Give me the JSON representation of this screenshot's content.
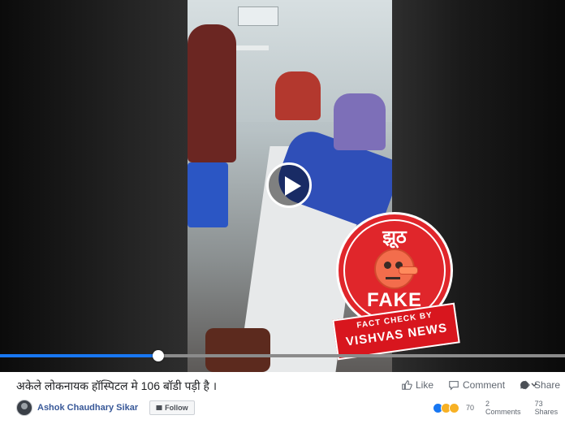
{
  "video": {
    "progress_fraction": 0.28
  },
  "fact_check_badge": {
    "top_word": "झूठ",
    "verdict": "FAKE",
    "banner_small": "FACT CHECK BY",
    "banner_big": "VISHVAS NEWS"
  },
  "post": {
    "caption": "अकेले लोकनायक हॉस्पिटल मे 106 बॉडी पड़ी है ।",
    "author": "Ashok Chaudhary Sikar",
    "follow_label": "Follow",
    "actions": {
      "like": "Like",
      "comment": "Comment",
      "share": "Share"
    },
    "reactions_count": "70",
    "comments_count": "2 Comments",
    "shares_count": "73 Shares"
  }
}
